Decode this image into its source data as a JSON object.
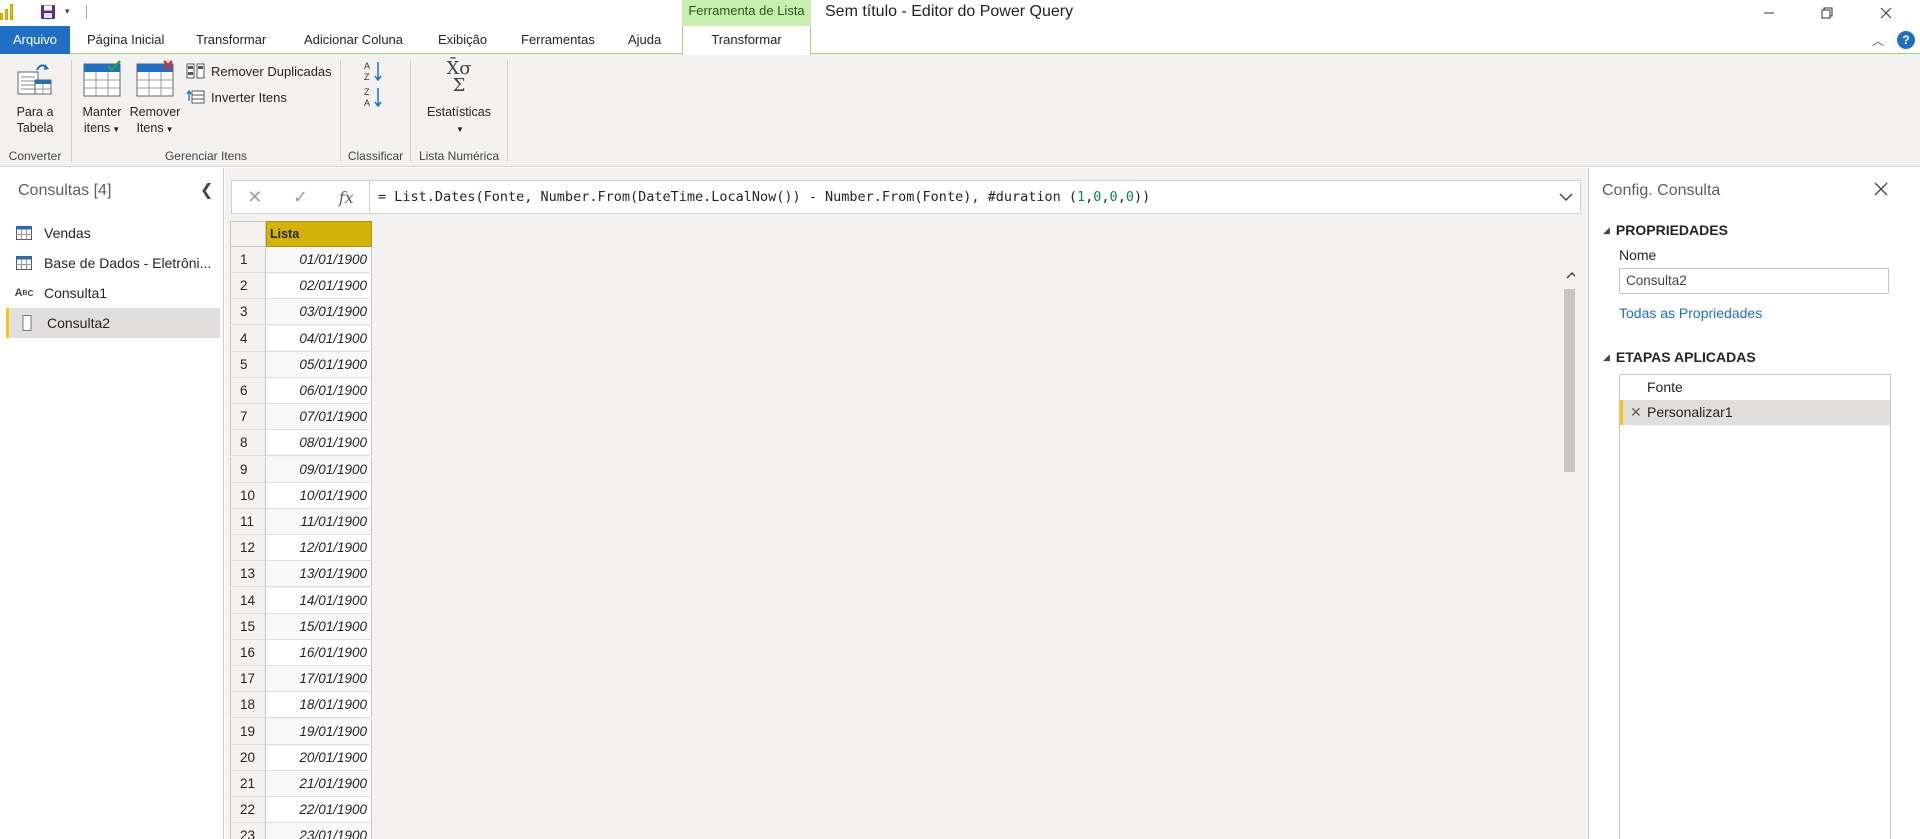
{
  "window": {
    "title": "Sem título - Editor do Power Query",
    "context_group": "Ferramenta de Lista"
  },
  "tabs": {
    "file": "Arquivo",
    "items": [
      "Página Inicial",
      "Transformar",
      "Adicionar Coluna",
      "Exibição",
      "Ferramentas",
      "Ajuda"
    ],
    "active": "Transformar"
  },
  "ribbon": {
    "to_table": {
      "line1": "Para a",
      "line2": "Tabela"
    },
    "keep_items": {
      "line1": "Manter",
      "line2": "itens"
    },
    "remove_items": {
      "line1": "Remover",
      "line2": "Itens"
    },
    "remove_duplicates": "Remover Duplicadas",
    "reverse_items": "Inverter Itens",
    "statistics": "Estatísticas",
    "statistics_glyph": "X̄σ",
    "sum_glyph": "Σ",
    "groups": {
      "convert": "Converter",
      "manage_items": "Gerenciar Itens",
      "sort": "Classificar",
      "numeric_list": "Lista Numérica"
    }
  },
  "queries": {
    "title": "Consultas [4]",
    "items": [
      {
        "label": "Vendas",
        "icon": "table-icon"
      },
      {
        "label": "Base de Dados - Eletrôni...",
        "icon": "table-icon"
      },
      {
        "label": "Consulta1",
        "icon": "abc-text-icon"
      },
      {
        "label": "Consulta2",
        "icon": "list-icon",
        "selected": true
      }
    ]
  },
  "formula_bar": {
    "fx": "fx",
    "formula_prefix": "= List.Dates(Fonte, Number.From(DateTime.LocalNow()) - Number.From(Fonte), #duration (",
    "formula_args": [
      "1",
      "0",
      "0",
      "0"
    ],
    "formula_suffix": "))"
  },
  "grid": {
    "column": "Lista",
    "rows": [
      {
        "n": "1",
        "v": "01/01/1900"
      },
      {
        "n": "2",
        "v": "02/01/1900"
      },
      {
        "n": "3",
        "v": "03/01/1900"
      },
      {
        "n": "4",
        "v": "04/01/1900"
      },
      {
        "n": "5",
        "v": "05/01/1900"
      },
      {
        "n": "6",
        "v": "06/01/1900"
      },
      {
        "n": "7",
        "v": "07/01/1900"
      },
      {
        "n": "8",
        "v": "08/01/1900"
      },
      {
        "n": "9",
        "v": "09/01/1900"
      },
      {
        "n": "10",
        "v": "10/01/1900"
      },
      {
        "n": "11",
        "v": "11/01/1900"
      },
      {
        "n": "12",
        "v": "12/01/1900"
      },
      {
        "n": "13",
        "v": "13/01/1900"
      },
      {
        "n": "14",
        "v": "14/01/1900"
      },
      {
        "n": "15",
        "v": "15/01/1900"
      },
      {
        "n": "16",
        "v": "16/01/1900"
      },
      {
        "n": "17",
        "v": "17/01/1900"
      },
      {
        "n": "18",
        "v": "18/01/1900"
      },
      {
        "n": "19",
        "v": "19/01/1900"
      },
      {
        "n": "20",
        "v": "20/01/1900"
      },
      {
        "n": "21",
        "v": "21/01/1900"
      },
      {
        "n": "22",
        "v": "22/01/1900"
      },
      {
        "n": "23",
        "v": "23/01/1900"
      }
    ]
  },
  "settings": {
    "title": "Config. Consulta",
    "properties_heading": "PROPRIEDADES",
    "name_label": "Nome",
    "name_value": "Consulta2",
    "all_properties_link": "Todas as Propriedades",
    "steps_heading": "ETAPAS APLICADAS",
    "steps": [
      {
        "label": "Fonte",
        "selected": false
      },
      {
        "label": "Personalizar1",
        "selected": true
      }
    ]
  },
  "colors": {
    "accent_blue": "#1f6fc4",
    "context_green": "#c6efb0",
    "selection_yellow": "#f2c811",
    "column_header": "#d4b208"
  }
}
